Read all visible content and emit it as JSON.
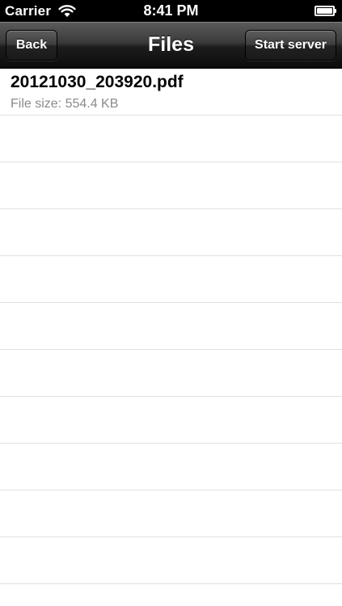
{
  "status_bar": {
    "carrier": "Carrier",
    "time": "8:41 PM",
    "wifi_icon": "wifi-icon",
    "battery_icon": "battery-icon",
    "battery_level": 1.0
  },
  "nav_bar": {
    "title": "Files",
    "back_label": "Back",
    "right_button_label": "Start server"
  },
  "files": [
    {
      "name": "20121030_203920.pdf",
      "size": "File size: 554.4 KB"
    }
  ],
  "colors": {
    "status_bar_bg": "#000000",
    "nav_bar_bg": "#1c1c1c",
    "secondary_text": "#8a8a8a",
    "separator": "#e0e0e0"
  }
}
